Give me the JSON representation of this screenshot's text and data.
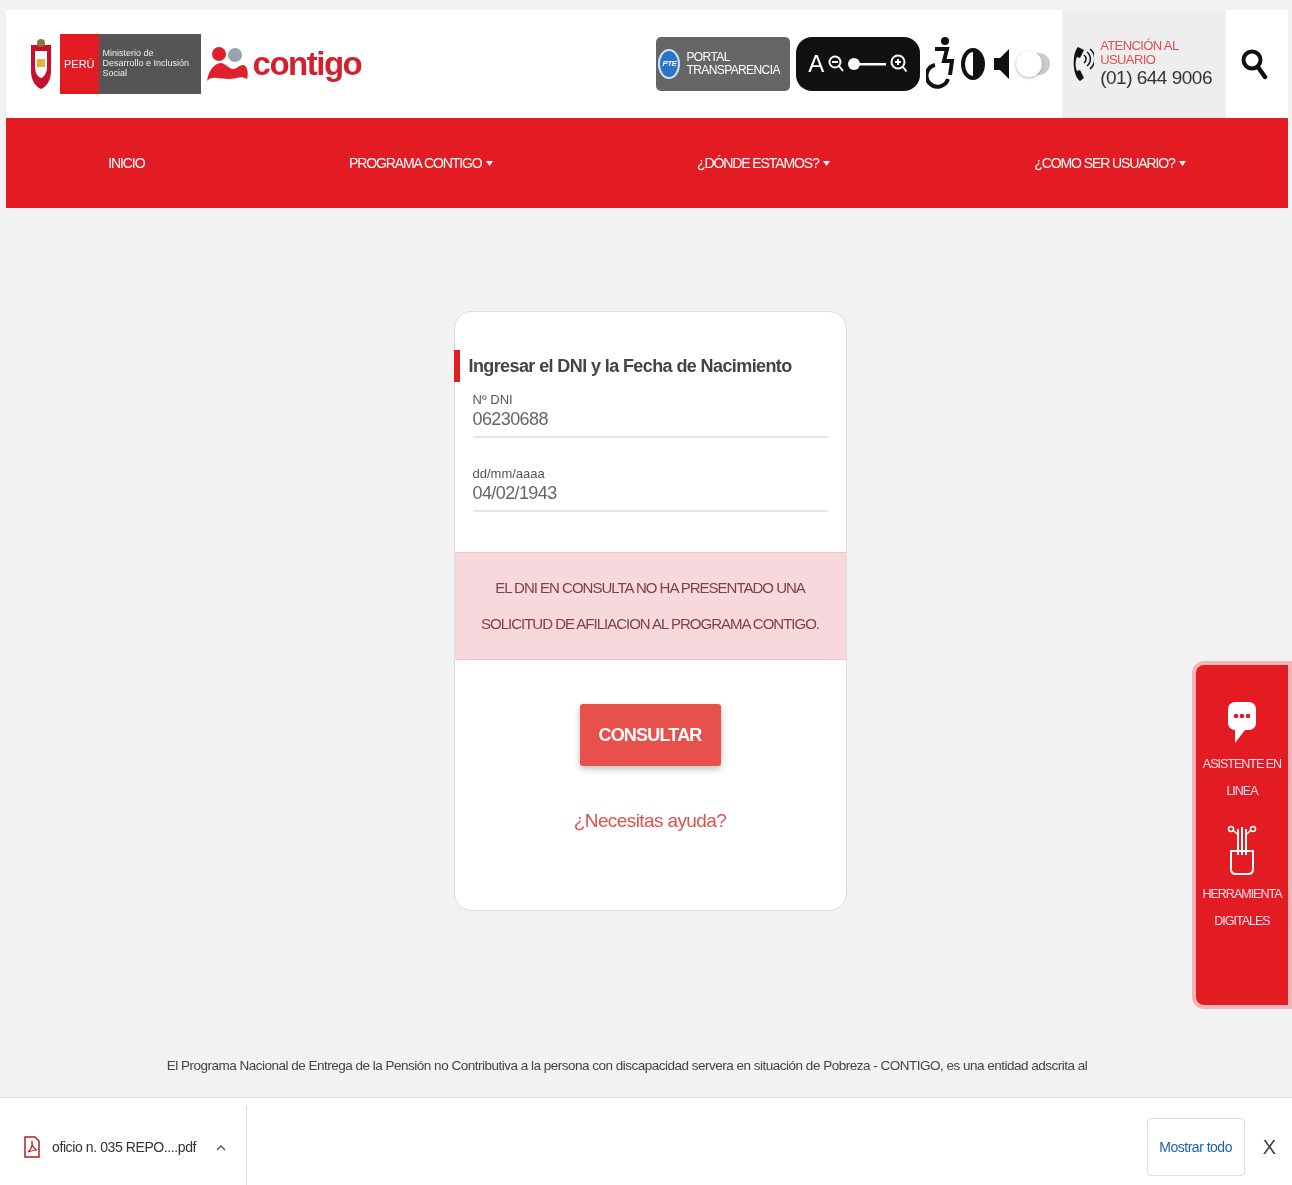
{
  "header": {
    "logo": {
      "country": "PERÚ",
      "ministry": "Ministerio de Desarrollo e Inclusión Social"
    },
    "brand": "contigo",
    "transparency": {
      "badge": "PTE",
      "label": "PORTAL TRANSPARENCIA"
    },
    "zoom_control": {
      "letter": "A"
    },
    "sound_toggle": {
      "on": false
    },
    "contact": {
      "label": "ATENCIÓN AL USUARIO",
      "phone": "(01) 644 9006"
    }
  },
  "nav": [
    {
      "label": "INICIO",
      "has_menu": false
    },
    {
      "label": "PROGRAMA CONTIGO",
      "has_menu": true
    },
    {
      "label": "¿DÓNDE ESTAMOS?",
      "has_menu": true
    },
    {
      "label": "¿COMO SER USUARIO?",
      "has_menu": true
    }
  ],
  "form": {
    "title": "Ingresar el DNI y la Fecha de Nacimiento",
    "fields": [
      {
        "label": "Nº DNI",
        "value": "06230688"
      },
      {
        "label": "dd/mm/aaaa",
        "value": "04/02/1943"
      }
    ],
    "alert": "EL DNI EN CONSULTA NO HA PRESENTADO UNA SOLICITUD DE AFILIACION AL PROGRAMA CONTIGO.",
    "button": "CONSULTAR",
    "help_link": "¿Necesitas ayuda?"
  },
  "side_panel": [
    {
      "kind": "chat",
      "label": "ASISTENTE EN LINEA"
    },
    {
      "kind": "touch",
      "label": "HERRAMIENTA DIGITALES"
    }
  ],
  "footer_text": "El Programa Nacional de Entrega de la Pensión no Contributiva a la persona con discapacidad servera en situación de Pobreza - CONTIGO, es una entidad adscrita al",
  "download_bar": {
    "file": "oficio n. 035 REPO....pdf",
    "show_all": "Mostrar todo",
    "close": "X"
  }
}
